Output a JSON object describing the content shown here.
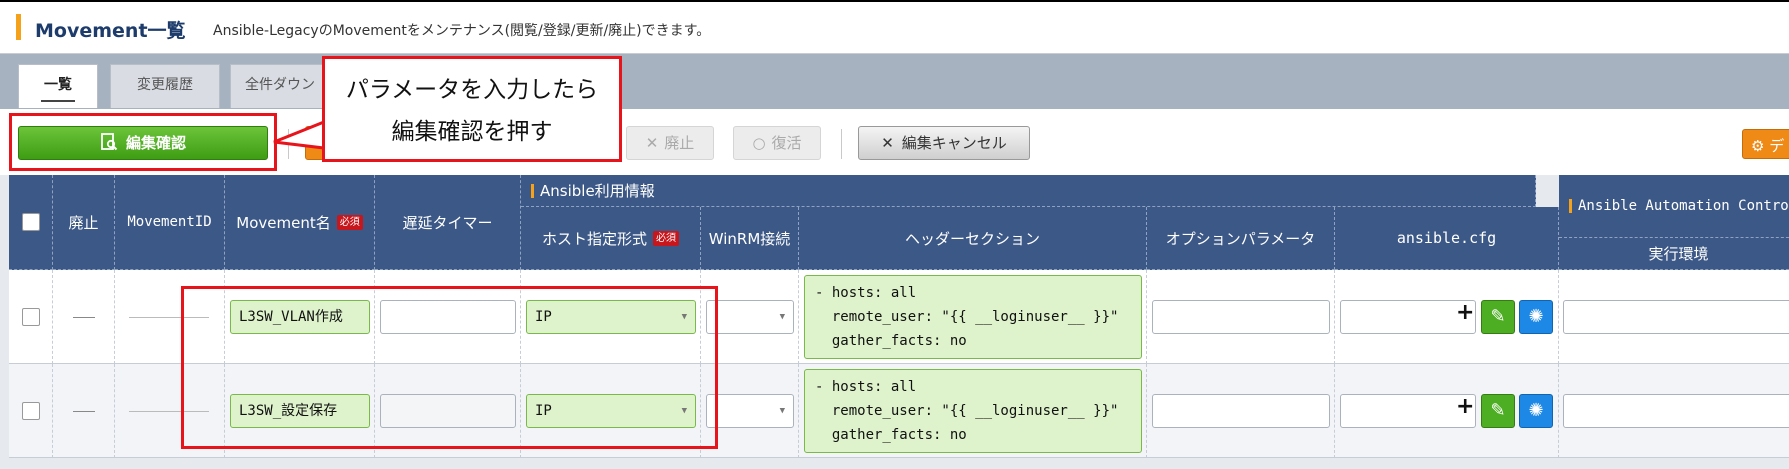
{
  "header": {
    "title": "Movement一覧",
    "description": "Ansible-LegacyのMovementをメンテナンス(閲覧/登録/更新/廃止)できます。"
  },
  "tabs": [
    {
      "label": "一覧",
      "active": true
    },
    {
      "label": "変更履歴",
      "active": false
    },
    {
      "label": "全件ダウン",
      "active": false
    }
  ],
  "toolbar": {
    "confirm_label": "編集確認",
    "discard_label": "廃止",
    "restore_label": "復活",
    "cancel_label": "編集キャンセル",
    "orange_label": "デ"
  },
  "callout": {
    "line1": "パラメータを入力したら",
    "line2": "編集確認を押す"
  },
  "table": {
    "columns": {
      "discard": "廃止",
      "movement_id": "MovementID",
      "movement_name": "Movement名",
      "delay_timer": "遅延タイマー",
      "ansible_group": "Ansible利用情報",
      "host_format": "ホスト指定形式",
      "winrm": "WinRM接続",
      "header_section": "ヘッダーセクション",
      "option_param": "オプションパラメータ",
      "ansible_cfg": "ansible.cfg",
      "aac_group": "Ansible Automation Contro",
      "exec_env": "実行環境"
    },
    "required_badge": "必須",
    "rows": [
      {
        "movement_name": "L3SW_VLAN作成",
        "host_format": "IP",
        "header_section": "- hosts: all\n  remote_user: \"{{ __loginuser__ }}\"\n  gather_facts: no"
      },
      {
        "movement_name": "L3SW_設定保存",
        "host_format": "IP",
        "header_section": "- hosts: all\n  remote_user: \"{{ __loginuser__ }}\"\n  gather_facts: no"
      }
    ]
  },
  "icons": {
    "confirm": "document-search-icon",
    "discard": "x-icon",
    "restore": "circle-icon",
    "cancel": "x-icon",
    "settings": "gear-icon",
    "add": "plus-icon",
    "edit": "edit-icon",
    "reset": "spinner-icon"
  },
  "colors": {
    "accent": "#f5a21a",
    "header_bg": "#3c5886",
    "green": "#4eae23",
    "annotation": "#e8141c"
  }
}
